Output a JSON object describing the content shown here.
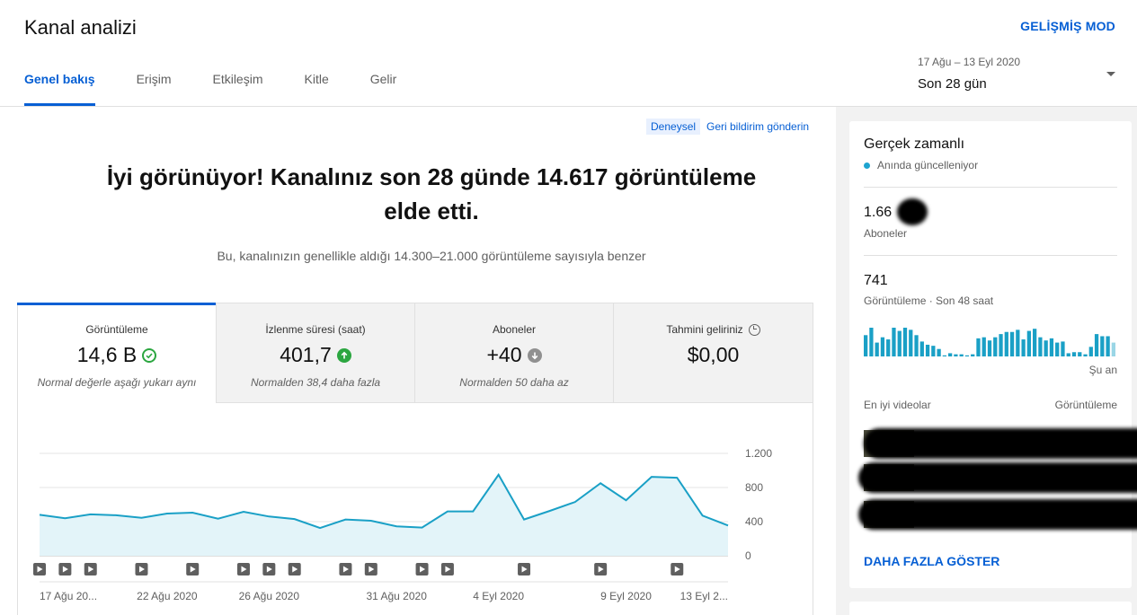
{
  "header": {
    "title": "Kanal analizi",
    "advanced_mode": "GELİŞMİŞ MOD",
    "tabs": [
      {
        "label": "Genel bakış",
        "active": true
      },
      {
        "label": "Erişim",
        "active": false
      },
      {
        "label": "Etkileşim",
        "active": false
      },
      {
        "label": "Kitle",
        "active": false
      },
      {
        "label": "Gelir",
        "active": false
      }
    ],
    "date_range": {
      "dates": "17 Ağu – 13 Eyl 2020",
      "label": "Son 28 gün"
    }
  },
  "main": {
    "badge": "Deneysel",
    "feedback": "Geri bildirim gönderin",
    "headline_line1": "İyi görünüyor! Kanalınız son 28 günde 14.617 görüntüleme",
    "headline_line2": "elde etti.",
    "subline": "Bu, kanalınızın genellikle aldığı 14.300–21.000 görüntüleme sayısıyla benzer",
    "metrics": [
      {
        "label": "Görüntüleme",
        "value": "14,6 B",
        "note": "Normal değerle aşağı yukarı aynı",
        "icon": "check-circle-icon"
      },
      {
        "label": "İzlenme süresi (saat)",
        "value": "401,7",
        "note": "Normalden 38,4 daha fazla",
        "icon": "arrow-up-icon"
      },
      {
        "label": "Aboneler",
        "value": "+40",
        "note": "Normalden 50 daha az",
        "icon": "arrow-down-icon"
      },
      {
        "label": "Tahmini geliriniz",
        "value": "$0,00",
        "note": "",
        "icon": "clock-icon"
      }
    ]
  },
  "chart_data": {
    "type": "area",
    "x": [
      "17 Ağu 2020",
      "18 Ağu",
      "19 Ağu",
      "20 Ağu",
      "21 Ağu",
      "22 Ağu 2020",
      "23 Ağu",
      "24 Ağu",
      "25 Ağu",
      "26 Ağu 2020",
      "27 Ağu",
      "28 Ağu",
      "29 Ağu",
      "30 Ağu",
      "31 Ağu 2020",
      "1 Eyl",
      "2 Eyl",
      "3 Eyl",
      "4 Eyl 2020",
      "5 Eyl",
      "6 Eyl",
      "7 Eyl",
      "8 Eyl",
      "9 Eyl 2020",
      "10 Eyl",
      "11 Eyl",
      "12 Eyl",
      "13 Eyl 2020"
    ],
    "y": [
      480,
      440,
      485,
      475,
      445,
      495,
      505,
      435,
      515,
      460,
      430,
      325,
      425,
      410,
      345,
      330,
      520,
      520,
      950,
      425,
      525,
      630,
      850,
      650,
      925,
      915,
      470,
      355
    ],
    "x_tick_labels": [
      "17 Ağu 20...",
      "22 Ağu 2020",
      "26 Ağu 2020",
      "31 Ağu 2020",
      "4 Eyl 2020",
      "9 Eyl 2020",
      "13 Eyl 2..."
    ],
    "x_tick_index": [
      0,
      5,
      9,
      14,
      18,
      23,
      27
    ],
    "y_ticks": [
      "0",
      "400",
      "800",
      "1.200"
    ],
    "ylim": [
      0,
      1200
    ],
    "video_markers": [
      0,
      1,
      2,
      4,
      6,
      8,
      9,
      10,
      12,
      13,
      15,
      16,
      19,
      22,
      25
    ],
    "grid": true,
    "color": "#1aa0c6",
    "fill": "#e3f4f9"
  },
  "realtime": {
    "title": "Gerçek zamanlı",
    "live_label": "Anında güncelleniyor",
    "subscribers_value": "1.66",
    "subscribers_label": "Aboneler",
    "views_value": "741",
    "views_label": "Görüntüleme · Son 48 saat",
    "now_label": "Şu an",
    "top_videos_label": "En iyi videolar",
    "top_views_label": "Görüntüleme",
    "more_button": "DAHA FAZLA GÖSTER",
    "bars": [
      20,
      27,
      13,
      18,
      16,
      27,
      24,
      27,
      25,
      20,
      14,
      11,
      10,
      7,
      1,
      3,
      2,
      2,
      1,
      2,
      17,
      18,
      15,
      18,
      21,
      23,
      23,
      25,
      16,
      24,
      26,
      18,
      15,
      17,
      13,
      14,
      3,
      4,
      4,
      2,
      9,
      21,
      19,
      19,
      13
    ]
  }
}
